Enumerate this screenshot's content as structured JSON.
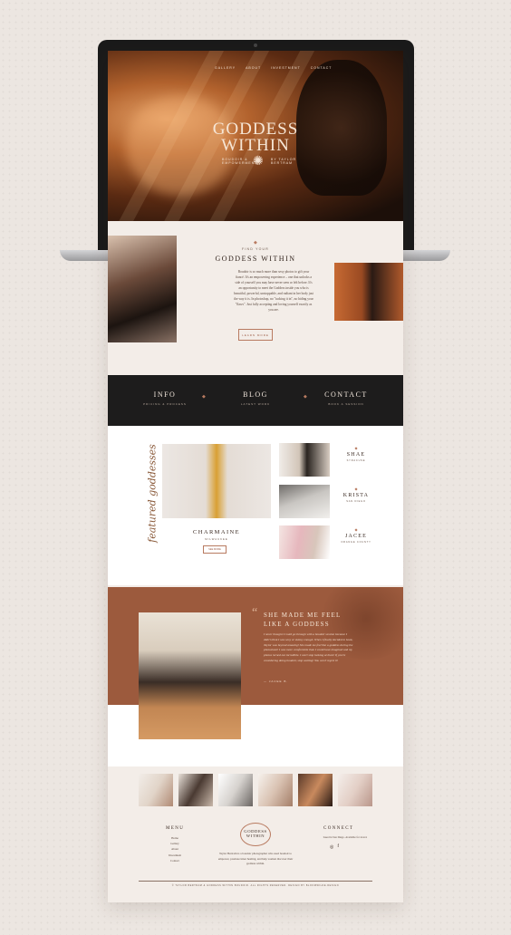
{
  "nav": [
    "GALLERY",
    "ABOUT",
    "INVESTMENT",
    "CONTACT"
  ],
  "hero": {
    "title_line1": "GODDESS",
    "title_line2": "WITHIN",
    "subtitle": "BOUDOIR &",
    "subtitle2": "EMPOWERMENT",
    "byline": "BY TAYLOR",
    "byline2": "BERTRAM"
  },
  "intro": {
    "eyebrow": "FIND YOUR",
    "heading": "GODDESS WITHIN",
    "body": "Boudoir is so much more than sexy photos to gift your fiancé. It's an empowering experience – one that unlocks a side of yourself you may have never seen or felt before. It's an opportunity to meet the Goddess inside you who is beautiful, powerful, unstoppable, and radiant in her body just the way it is. In photoshop, no \"tucking it in\", no hiding your \"flaws\". Just fully accepting and loving yourself exactly as you are.",
    "button": "LEARN MORE"
  },
  "blackbar": [
    {
      "title": "INFO",
      "sub": "PRICING & PROCESS"
    },
    {
      "title": "BLOG",
      "sub": "LATEST WORK"
    },
    {
      "title": "CONTACT",
      "sub": "BOOK A SESSION"
    }
  ],
  "featured": {
    "script_label": "featured goddesses",
    "main_name": "CHARMAINE",
    "main_location": "MILWAUKEE",
    "main_button": "SEE MORE",
    "side": [
      {
        "name": "SHAE",
        "location": "SYRACUSE"
      },
      {
        "name": "KRISTA",
        "location": "SAN DIEGO"
      },
      {
        "name": "JACEE",
        "location": "ORANGE COUNTY"
      }
    ]
  },
  "testimonial": {
    "quote_mark": "“",
    "heading_line1": "SHE MADE ME FEEL",
    "heading_line2": "LIKE A GODDESS",
    "body": "I never thought I could go through with a boudoir session because I didn't think I was sexy or skinny enough. When I finally decided to book, Taylor was beyond amazing! She made me feel like a goddess during the photoshoot! I was more comfortable than I could have imagined and my photos turned out incredible. I can't stop looking at them! If you're considering doing boudoir, stop waiting! You won't regret it!",
    "author": "— JACEE B."
  },
  "footer": {
    "menu_title": "MENU",
    "menu_items": [
      "Home",
      "Gallery",
      "About",
      "Investment",
      "Contact"
    ],
    "logo_line1": "GODDESS",
    "logo_line2": "WITHIN",
    "about": "Taylor Bertram is a boudoir photographer who used boudoir to empower, promote inner healing, and help women discover their goddess within.",
    "connect_title": "CONNECT",
    "connect_sub": "based in San Diego. Available for travel.",
    "copyright": "© TAYLOR BERTRAM & GODDESS WITHIN BOUDOIR. ALL RIGHTS RESERVED. DESIGN BY BLOOMWILDE.DESIGN"
  },
  "colors": {
    "accent": "#b87a60",
    "dark_band": "#1d1c1c",
    "testimonial_bg": "#9c5a3d",
    "page_bg": "#f3ede8"
  }
}
